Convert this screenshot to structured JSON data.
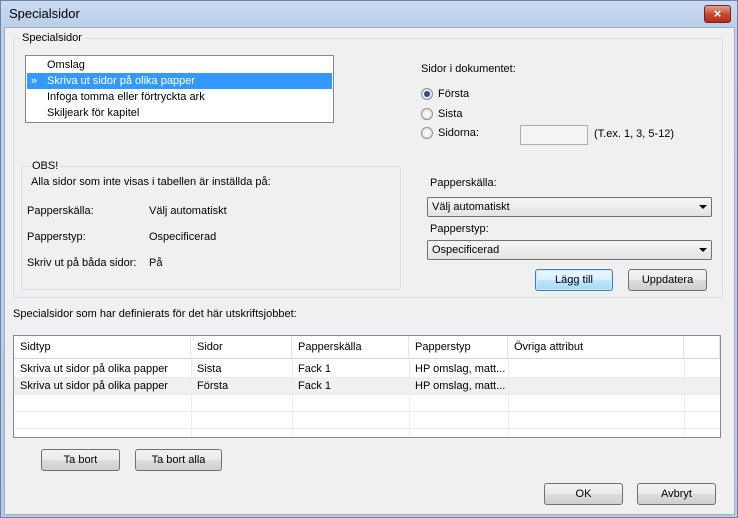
{
  "window": {
    "title": "Specialsidor",
    "close_glyph": "×"
  },
  "main_group": {
    "label": "Specialsidor"
  },
  "list": {
    "items": [
      {
        "label": "Omslag",
        "selected": false
      },
      {
        "label": "Skriva ut sidor på olika papper",
        "selected": true
      },
      {
        "label": "Infoga tomma eller förtryckta ark",
        "selected": false
      },
      {
        "label": "Skiljeark för kapitel",
        "selected": false
      }
    ],
    "selected_marker": "»"
  },
  "pages": {
    "label": "Sidor i dokumentet:",
    "first": "Första",
    "last": "Sista",
    "pages": "Sidorna:",
    "pages_value": "",
    "example": "(T.ex. 1, 3, 5-12)"
  },
  "obs": {
    "label": "OBS!",
    "note": "Alla sidor som inte visas i tabellen är inställda på:",
    "rows": [
      {
        "key": "Papperskälla:",
        "value": "Välj automatiskt"
      },
      {
        "key": "Papperstyp:",
        "value": "Ospecificerad"
      },
      {
        "key": "Skriv ut på båda sidor:",
        "value": "På"
      }
    ]
  },
  "paper": {
    "source_label": "Papperskälla:",
    "source_value": "Välj automatiskt",
    "type_label": "Papperstyp:",
    "type_value": "Ospecificerad"
  },
  "buttons": {
    "add": "Lägg till",
    "update": "Uppdatera",
    "remove": "Ta bort",
    "remove_all": "Ta bort alla",
    "ok": "OK",
    "cancel": "Avbryt"
  },
  "table": {
    "caption": "Specialsidor som har definierats för det här utskriftsjobbet:",
    "columns": [
      "Sidtyp",
      "Sidor",
      "Papperskälla",
      "Papperstyp",
      "Övriga attribut"
    ],
    "rows": [
      [
        "Skriva ut sidor på olika papper",
        "Sista",
        "Fack 1",
        "HP omslag, matt...",
        ""
      ],
      [
        "Skriva ut sidor på olika papper",
        "Första",
        "Fack 1",
        "HP omslag, matt...",
        ""
      ]
    ]
  }
}
